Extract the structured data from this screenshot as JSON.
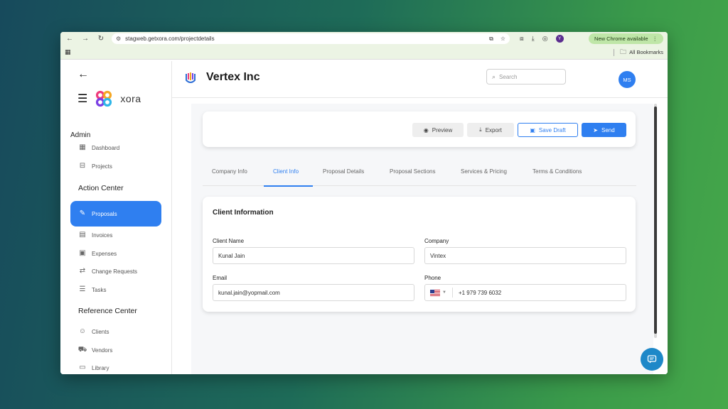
{
  "browser": {
    "url": "stagweb.getxora.com/projectdetails",
    "profile_initial": "Y",
    "new_chrome_label": "New Chrome available",
    "all_bookmarks_label": "All Bookmarks"
  },
  "sidebar": {
    "logo_text": "xora",
    "admin_title": "Admin",
    "admin_items": [
      {
        "label": "Dashboard",
        "icon": "grid-icon"
      },
      {
        "label": "Projects",
        "icon": "briefcase-icon"
      }
    ],
    "action_title": "Action Center",
    "action_items": [
      {
        "label": "Proposals",
        "icon": "document-edit-icon",
        "active": true
      },
      {
        "label": "Invoices",
        "icon": "invoice-icon"
      },
      {
        "label": "Expenses",
        "icon": "wallet-icon"
      },
      {
        "label": "Change Requests",
        "icon": "swap-icon"
      },
      {
        "label": "Tasks",
        "icon": "checklist-icon"
      }
    ],
    "reference_title": "Reference Center",
    "reference_items": [
      {
        "label": "Clients",
        "icon": "users-icon"
      },
      {
        "label": "Vendors",
        "icon": "truck-icon"
      },
      {
        "label": "Library",
        "icon": "book-icon"
      }
    ]
  },
  "header": {
    "company_name": "Vertex Inc",
    "search_placeholder": "Search",
    "avatar_initials": "MS"
  },
  "actions": {
    "preview": "Preview",
    "export": "Export",
    "save_draft": "Save Draft",
    "send": "Send"
  },
  "tabs": [
    {
      "label": "Company Info",
      "active": false
    },
    {
      "label": "Client Info",
      "active": true
    },
    {
      "label": "Proposal Details",
      "active": false
    },
    {
      "label": "Proposal Sections",
      "active": false
    },
    {
      "label": "Services & Pricing",
      "active": false
    },
    {
      "label": "Terms & Conditions",
      "active": false
    }
  ],
  "client_form": {
    "title": "Client Information",
    "client_name_label": "Client Name",
    "client_name_value": "Kunal Jain",
    "company_label": "Company",
    "company_value": "Vintex",
    "email_label": "Email",
    "email_value": "kunal.jain@yopmail.com",
    "phone_label": "Phone",
    "phone_value": "+1 979 739 6032"
  },
  "colors": {
    "accent": "#2f7ff0",
    "chat_button": "#1e88c8"
  }
}
